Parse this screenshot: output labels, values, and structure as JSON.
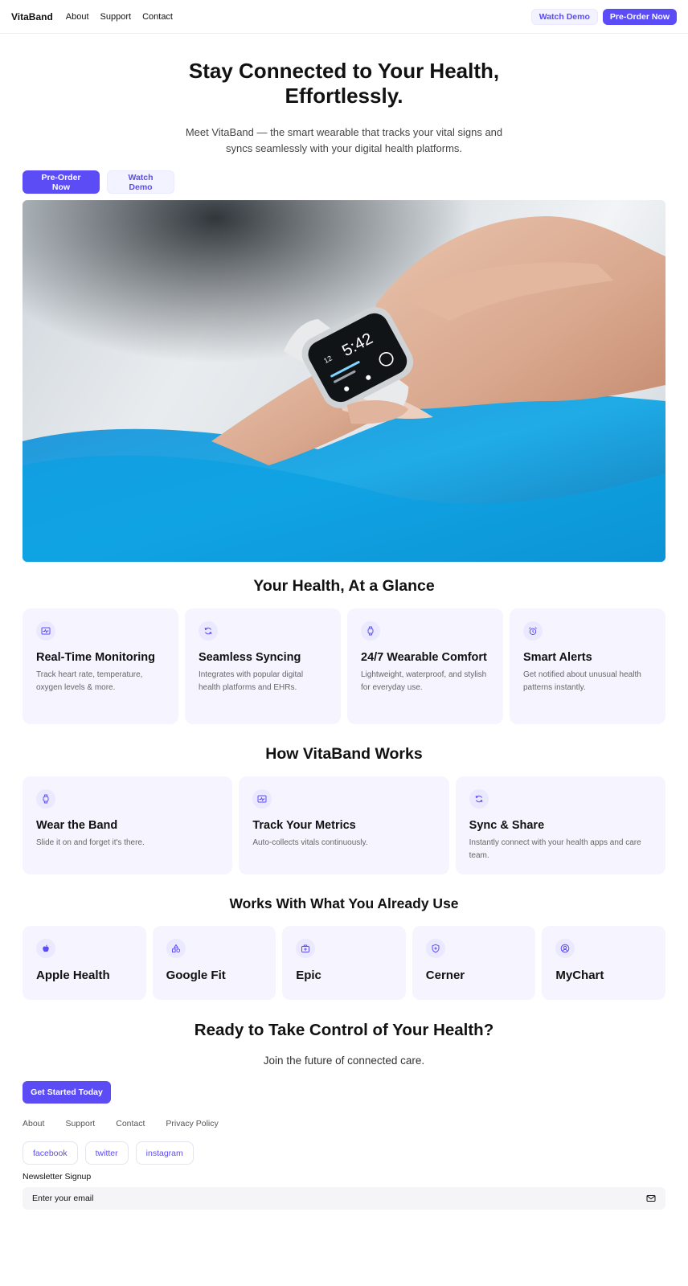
{
  "nav": {
    "brand": "VitaBand",
    "links": [
      "About",
      "Support",
      "Contact"
    ],
    "watch_demo": "Watch Demo",
    "pre_order": "Pre-Order Now"
  },
  "hero": {
    "title": "Stay Connected to Your Health, Effortlessly.",
    "subtitle": "Meet VitaBand — the smart wearable that tracks your vital signs and syncs seamlessly with your digital health platforms.",
    "pre_order": "Pre-Order Now",
    "watch_demo": "Watch Demo",
    "watch_time": "5:42",
    "watch_date": "12"
  },
  "glance": {
    "title": "Your Health, At a Glance",
    "cards": [
      {
        "icon": "activity-icon",
        "title": "Real-Time Monitoring",
        "text": "Track heart rate, temperature, oxygen levels & more."
      },
      {
        "icon": "sync-icon",
        "title": "Seamless Syncing",
        "text": "Integrates with popular digital health platforms and EHRs."
      },
      {
        "icon": "watch-icon",
        "title": "24/7 Wearable Comfort",
        "text": "Lightweight, waterproof, and stylish for everyday use."
      },
      {
        "icon": "alarm-icon",
        "title": "Smart Alerts",
        "text": "Get notified about unusual health patterns instantly."
      }
    ]
  },
  "how": {
    "title": "How VitaBand Works",
    "cards": [
      {
        "icon": "watch-icon",
        "title": "Wear the Band",
        "text": "Slide it on and forget it's there."
      },
      {
        "icon": "activity-icon",
        "title": "Track Your Metrics",
        "text": "Auto-collects vitals continuously."
      },
      {
        "icon": "sync-icon",
        "title": "Sync & Share",
        "text": "Instantly connect with your health apps and care team."
      }
    ]
  },
  "integrations": {
    "title": "Works With What You Already Use",
    "items": [
      {
        "icon": "apple-icon",
        "name": "Apple Health"
      },
      {
        "icon": "shapes-icon",
        "name": "Google Fit"
      },
      {
        "icon": "medical-bag-icon",
        "name": "Epic"
      },
      {
        "icon": "shield-plus-icon",
        "name": "Cerner"
      },
      {
        "icon": "user-circle-icon",
        "name": "MyChart"
      }
    ]
  },
  "cta": {
    "title": "Ready to Take Control of Your Health?",
    "subtitle": "Join the future of connected care.",
    "button": "Get Started Today"
  },
  "footer": {
    "links": [
      "About",
      "Support",
      "Contact",
      "Privacy Policy"
    ],
    "socials": [
      "facebook",
      "twitter",
      "instagram"
    ],
    "newsletter_label": "Newsletter Signup",
    "email_placeholder": "Enter your email"
  },
  "colors": {
    "accent": "#5b4cf5",
    "card_bg": "#f5f4ff",
    "icon_bg": "#ebe9ff"
  }
}
